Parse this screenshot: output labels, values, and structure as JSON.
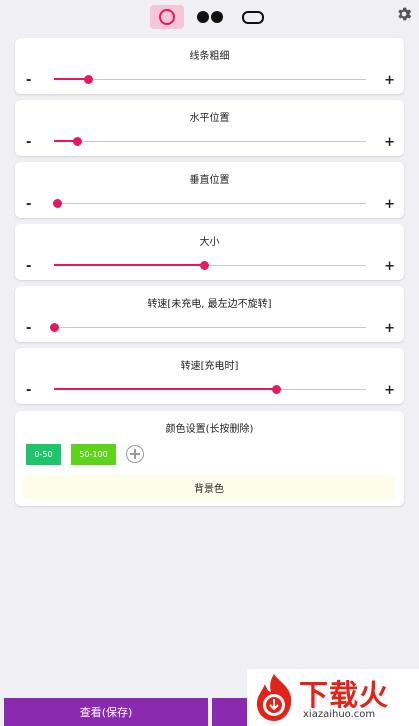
{
  "top_tabs": [
    {
      "name": "ring-tab",
      "selected": true
    },
    {
      "name": "dots-tab",
      "selected": false
    },
    {
      "name": "pill-tab",
      "selected": false
    }
  ],
  "settings_icon": "gear-icon",
  "sliders": [
    {
      "id": "line-thickness",
      "label": "线条粗细",
      "value": 0.11
    },
    {
      "id": "horizontal-position",
      "label": "水平位置",
      "value": 0.075
    },
    {
      "id": "vertical-position",
      "label": "垂直位置",
      "value": 0.01
    },
    {
      "id": "size",
      "label": "大小",
      "value": 0.48
    },
    {
      "id": "speed-not-charging",
      "label": "转速[未充电, 最左边不旋转]",
      "value": 0.0
    },
    {
      "id": "speed-charging",
      "label": "转速[充电时]",
      "value": 0.71
    }
  ],
  "signs": {
    "minus": "-",
    "plus": "+"
  },
  "color_settings": {
    "title": "颜色设置(长按删除)",
    "chips": [
      {
        "label": "0-50",
        "color": "#1ec46a"
      },
      {
        "label": "50-100",
        "color": "#5fd21c"
      }
    ],
    "background_label": "背景色"
  },
  "bottom": {
    "view_save_label": "查看(保存)"
  },
  "watermark": {
    "brand": "下载火",
    "url": "xiazaihuo.com"
  },
  "colors": {
    "accent": "#e8185e",
    "button": "#8a2ab0"
  }
}
